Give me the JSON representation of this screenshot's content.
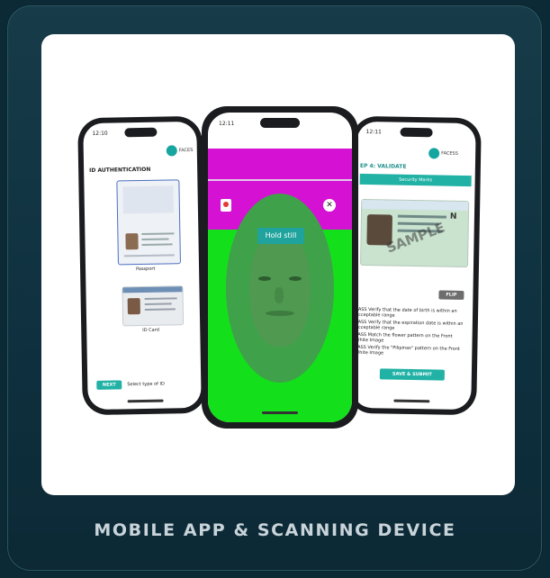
{
  "caption": "MOBILE APP & SCANNING DEVICE",
  "colors": {
    "teal": "#21b2a5",
    "magenta": "#d511d4",
    "green": "#13e01a",
    "oval_green": "#3fa14a"
  },
  "left_phone": {
    "status_time": "12:10",
    "brand": "FACES",
    "heading": "ID AUTHENTICATION",
    "doc1_label": "Passport",
    "doc2_label": "ID Card",
    "next_button": "NEXT",
    "select_type": "Select type of ID"
  },
  "center_phone": {
    "status_time": "12:11",
    "hint": "Hold still",
    "close_icon": "close-icon"
  },
  "right_phone": {
    "status_time": "12:11",
    "brand": "FACESS",
    "step_title": "EP 4: VALIDATE",
    "banner": "Security Marks",
    "sample": "SAMPLE",
    "flip_button": "FLIP",
    "checks": [
      "PASS Verify that the date of birth is within an acceptable range",
      "PASS Verify that the expiration date is within an acceptable range",
      "PASS Match the flower pattern on the Front White Image",
      "PASS Verify the \"Pilipinas\" pattern on the Front White Image"
    ],
    "save_button": "SAVE & SUBMIT"
  }
}
